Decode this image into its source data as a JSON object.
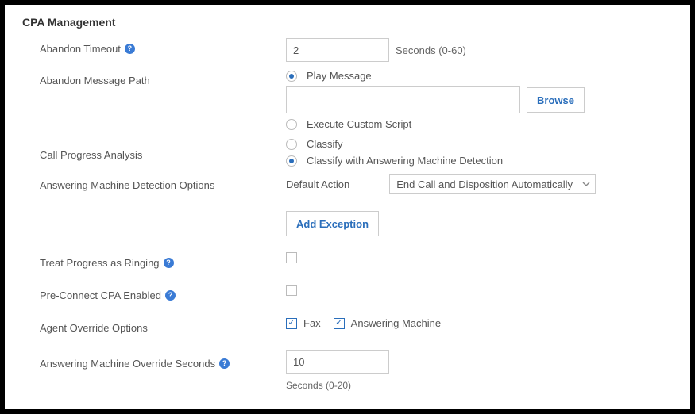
{
  "section_title": "CPA Management",
  "abandon_timeout": {
    "label": "Abandon Timeout",
    "value": "2",
    "unit": "Seconds (0-60)"
  },
  "abandon_message_path": {
    "label": "Abandon Message Path",
    "options": {
      "play_message": "Play Message",
      "execute_script": "Execute Custom Script"
    },
    "path_value": "",
    "browse": "Browse"
  },
  "call_progress_analysis": {
    "label": "Call Progress Analysis",
    "options": {
      "classify": "Classify",
      "classify_amd": "Classify with Answering Machine Detection"
    }
  },
  "amd_options": {
    "label": "Answering Machine Detection Options",
    "default_action_label": "Default Action",
    "default_action_value": "End Call and Disposition Automatically",
    "add_exception": "Add Exception"
  },
  "treat_progress_ringing": {
    "label": "Treat Progress as Ringing"
  },
  "pre_connect_cpa": {
    "label": "Pre-Connect CPA Enabled"
  },
  "agent_override": {
    "label": "Agent Override Options",
    "fax": "Fax",
    "answering_machine": "Answering Machine"
  },
  "am_override_seconds": {
    "label": "Answering Machine Override Seconds",
    "value": "10",
    "hint": "Seconds (0-20)"
  }
}
